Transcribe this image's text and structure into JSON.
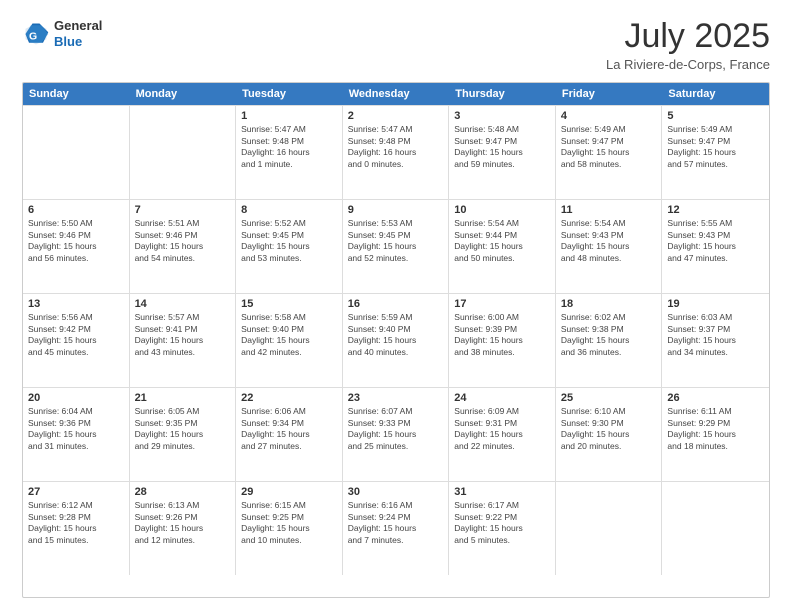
{
  "logo": {
    "line1": "General",
    "line2": "Blue"
  },
  "title": "July 2025",
  "location": "La Riviere-de-Corps, France",
  "days_header": [
    "Sunday",
    "Monday",
    "Tuesday",
    "Wednesday",
    "Thursday",
    "Friday",
    "Saturday"
  ],
  "weeks": [
    [
      {
        "day": "",
        "info": ""
      },
      {
        "day": "",
        "info": ""
      },
      {
        "day": "1",
        "info": "Sunrise: 5:47 AM\nSunset: 9:48 PM\nDaylight: 16 hours\nand 1 minute."
      },
      {
        "day": "2",
        "info": "Sunrise: 5:47 AM\nSunset: 9:48 PM\nDaylight: 16 hours\nand 0 minutes."
      },
      {
        "day": "3",
        "info": "Sunrise: 5:48 AM\nSunset: 9:47 PM\nDaylight: 15 hours\nand 59 minutes."
      },
      {
        "day": "4",
        "info": "Sunrise: 5:49 AM\nSunset: 9:47 PM\nDaylight: 15 hours\nand 58 minutes."
      },
      {
        "day": "5",
        "info": "Sunrise: 5:49 AM\nSunset: 9:47 PM\nDaylight: 15 hours\nand 57 minutes."
      }
    ],
    [
      {
        "day": "6",
        "info": "Sunrise: 5:50 AM\nSunset: 9:46 PM\nDaylight: 15 hours\nand 56 minutes."
      },
      {
        "day": "7",
        "info": "Sunrise: 5:51 AM\nSunset: 9:46 PM\nDaylight: 15 hours\nand 54 minutes."
      },
      {
        "day": "8",
        "info": "Sunrise: 5:52 AM\nSunset: 9:45 PM\nDaylight: 15 hours\nand 53 minutes."
      },
      {
        "day": "9",
        "info": "Sunrise: 5:53 AM\nSunset: 9:45 PM\nDaylight: 15 hours\nand 52 minutes."
      },
      {
        "day": "10",
        "info": "Sunrise: 5:54 AM\nSunset: 9:44 PM\nDaylight: 15 hours\nand 50 minutes."
      },
      {
        "day": "11",
        "info": "Sunrise: 5:54 AM\nSunset: 9:43 PM\nDaylight: 15 hours\nand 48 minutes."
      },
      {
        "day": "12",
        "info": "Sunrise: 5:55 AM\nSunset: 9:43 PM\nDaylight: 15 hours\nand 47 minutes."
      }
    ],
    [
      {
        "day": "13",
        "info": "Sunrise: 5:56 AM\nSunset: 9:42 PM\nDaylight: 15 hours\nand 45 minutes."
      },
      {
        "day": "14",
        "info": "Sunrise: 5:57 AM\nSunset: 9:41 PM\nDaylight: 15 hours\nand 43 minutes."
      },
      {
        "day": "15",
        "info": "Sunrise: 5:58 AM\nSunset: 9:40 PM\nDaylight: 15 hours\nand 42 minutes."
      },
      {
        "day": "16",
        "info": "Sunrise: 5:59 AM\nSunset: 9:40 PM\nDaylight: 15 hours\nand 40 minutes."
      },
      {
        "day": "17",
        "info": "Sunrise: 6:00 AM\nSunset: 9:39 PM\nDaylight: 15 hours\nand 38 minutes."
      },
      {
        "day": "18",
        "info": "Sunrise: 6:02 AM\nSunset: 9:38 PM\nDaylight: 15 hours\nand 36 minutes."
      },
      {
        "day": "19",
        "info": "Sunrise: 6:03 AM\nSunset: 9:37 PM\nDaylight: 15 hours\nand 34 minutes."
      }
    ],
    [
      {
        "day": "20",
        "info": "Sunrise: 6:04 AM\nSunset: 9:36 PM\nDaylight: 15 hours\nand 31 minutes."
      },
      {
        "day": "21",
        "info": "Sunrise: 6:05 AM\nSunset: 9:35 PM\nDaylight: 15 hours\nand 29 minutes."
      },
      {
        "day": "22",
        "info": "Sunrise: 6:06 AM\nSunset: 9:34 PM\nDaylight: 15 hours\nand 27 minutes."
      },
      {
        "day": "23",
        "info": "Sunrise: 6:07 AM\nSunset: 9:33 PM\nDaylight: 15 hours\nand 25 minutes."
      },
      {
        "day": "24",
        "info": "Sunrise: 6:09 AM\nSunset: 9:31 PM\nDaylight: 15 hours\nand 22 minutes."
      },
      {
        "day": "25",
        "info": "Sunrise: 6:10 AM\nSunset: 9:30 PM\nDaylight: 15 hours\nand 20 minutes."
      },
      {
        "day": "26",
        "info": "Sunrise: 6:11 AM\nSunset: 9:29 PM\nDaylight: 15 hours\nand 18 minutes."
      }
    ],
    [
      {
        "day": "27",
        "info": "Sunrise: 6:12 AM\nSunset: 9:28 PM\nDaylight: 15 hours\nand 15 minutes."
      },
      {
        "day": "28",
        "info": "Sunrise: 6:13 AM\nSunset: 9:26 PM\nDaylight: 15 hours\nand 12 minutes."
      },
      {
        "day": "29",
        "info": "Sunrise: 6:15 AM\nSunset: 9:25 PM\nDaylight: 15 hours\nand 10 minutes."
      },
      {
        "day": "30",
        "info": "Sunrise: 6:16 AM\nSunset: 9:24 PM\nDaylight: 15 hours\nand 7 minutes."
      },
      {
        "day": "31",
        "info": "Sunrise: 6:17 AM\nSunset: 9:22 PM\nDaylight: 15 hours\nand 5 minutes."
      },
      {
        "day": "",
        "info": ""
      },
      {
        "day": "",
        "info": ""
      }
    ]
  ]
}
